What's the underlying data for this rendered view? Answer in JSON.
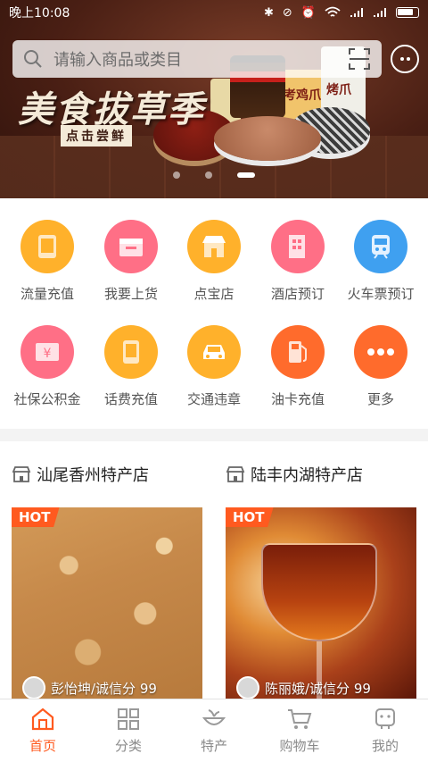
{
  "status_bar": {
    "time": "晚上10:08"
  },
  "banner": {
    "title": "美食拔草季",
    "subtitle": "点击尝鲜",
    "bag_text_1": "考鸡爪",
    "bag_text_2": "烤爪",
    "dots": 3,
    "active_dot": 2
  },
  "search": {
    "placeholder": "请输入商品或类目"
  },
  "functions": [
    {
      "label": "流量充值",
      "color": "#ffb12b",
      "icon": "tablet-icon"
    },
    {
      "label": "我要上货",
      "color": "#ff6f86",
      "icon": "box-icon"
    },
    {
      "label": "点宝店",
      "color": "#ffb12b",
      "icon": "store-icon"
    },
    {
      "label": "酒店预订",
      "color": "#ff6f86",
      "icon": "hotel-icon"
    },
    {
      "label": "火车票预订",
      "color": "#3fa0f0",
      "icon": "train-icon"
    },
    {
      "label": "社保公积金",
      "color": "#ff6f86",
      "icon": "yuan-icon"
    },
    {
      "label": "话费充值",
      "color": "#ffb12b",
      "icon": "phone-icon"
    },
    {
      "label": "交通违章",
      "color": "#ffb12b",
      "icon": "car-icon"
    },
    {
      "label": "油卡充值",
      "color": "#ff6b2c",
      "icon": "fuel-icon"
    },
    {
      "label": "更多",
      "color": "#ff6b2c",
      "icon": "more-icon"
    }
  ],
  "stores": [
    {
      "name": "汕尾香州特产店",
      "badge": "HOT",
      "owner": "彭怡坤/诚信分 99"
    },
    {
      "name": "陆丰内湖特产店",
      "badge": "HOT",
      "owner": "陈丽娥/诚信分 99"
    }
  ],
  "bottom_nav": [
    {
      "label": "首页",
      "icon": "home-icon",
      "active": true
    },
    {
      "label": "分类",
      "icon": "grid-icon",
      "active": false
    },
    {
      "label": "特产",
      "icon": "specialty-icon",
      "active": false
    },
    {
      "label": "购物车",
      "icon": "cart-icon",
      "active": false
    },
    {
      "label": "我的",
      "icon": "profile-icon",
      "active": false
    }
  ],
  "colors": {
    "accent": "#ff5a1f"
  }
}
